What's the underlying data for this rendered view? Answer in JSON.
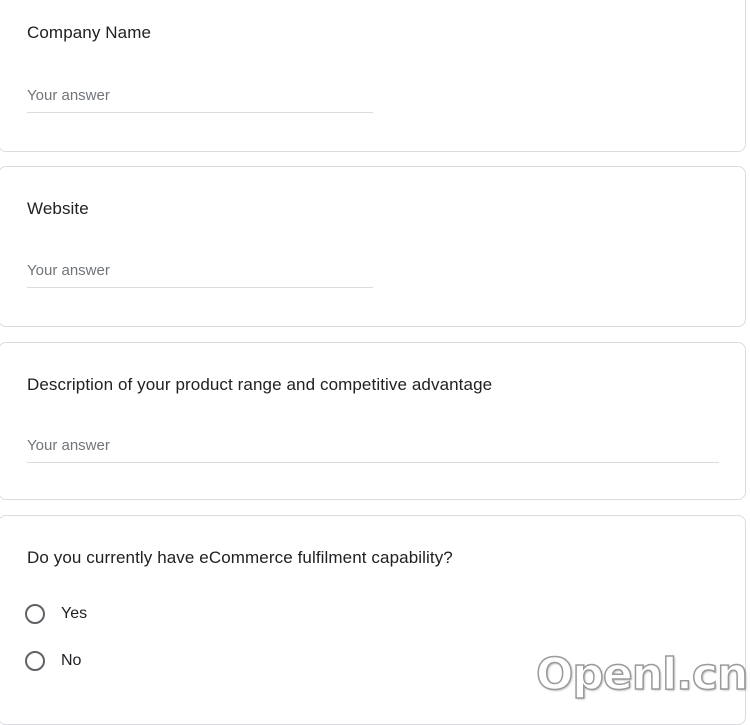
{
  "questions": [
    {
      "title": "Company Name",
      "placeholder": "Your answer"
    },
    {
      "title": "Website",
      "placeholder": "Your answer"
    },
    {
      "title": "Description of your product range and competitive advantage",
      "placeholder": "Your answer"
    },
    {
      "title": "Do you currently have eCommerce fulfilment capability?",
      "options": [
        "Yes",
        "No"
      ]
    }
  ],
  "watermark": "Openl.cn"
}
